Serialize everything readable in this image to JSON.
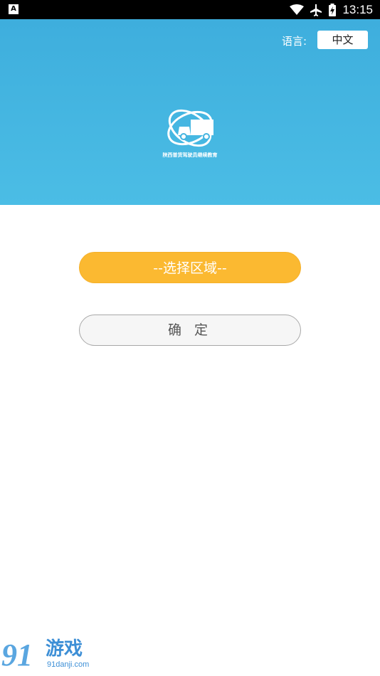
{
  "status_bar": {
    "time": "13:15",
    "icons": [
      "a-notification-icon",
      "wifi-icon",
      "airplane-icon",
      "battery-icon"
    ]
  },
  "header": {
    "language_label": "语言:",
    "language_value": "中文",
    "logo_caption": "陕西普货驾驶员继续教育",
    "background_color": "#44b4e0"
  },
  "main": {
    "region_button_label": "--选择区域--",
    "confirm_button_label": "确 定",
    "accent_color": "#fbb931"
  },
  "watermark": {
    "number": "91",
    "brand": "游戏",
    "url": "91danji.com"
  }
}
